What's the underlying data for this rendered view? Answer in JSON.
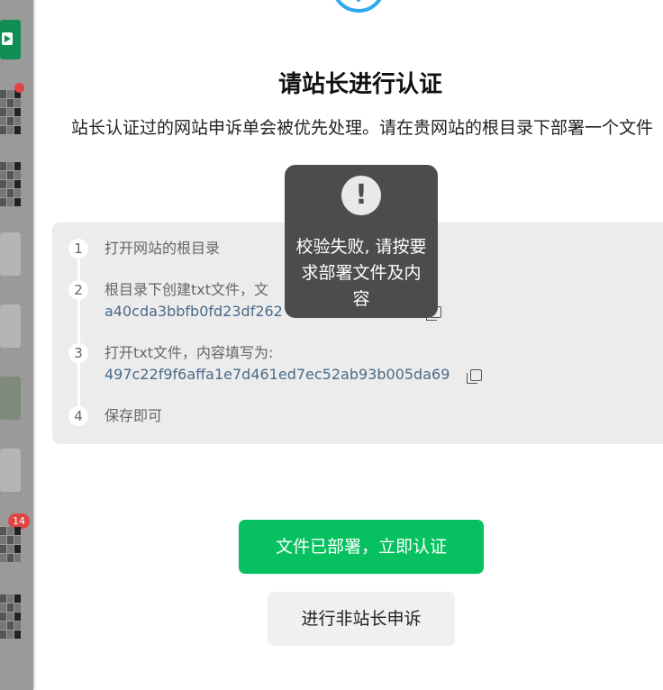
{
  "dialog": {
    "title": "请站长进行认证",
    "description": "站长认证过的网站申诉单会被优先处理。请在贵网站的根目录下部署一个文件"
  },
  "steps": [
    {
      "number": "1",
      "text": "打开网站的根目录"
    },
    {
      "number": "2",
      "text": "根目录下创建txt文件，文",
      "value": "a40cda3bbfb0fd23df262"
    },
    {
      "number": "3",
      "text": "打开txt文件，内容填写为:",
      "value": "497c22f9f6affa1e7d461ed7ec52ab93b005da69"
    },
    {
      "number": "4",
      "text": "保存即可"
    }
  ],
  "toast": {
    "icon": "exclamation-icon",
    "message": "校验失败, 请按要求部署文件及内容"
  },
  "buttons": {
    "confirm_label": "文件已部署，立即认证",
    "appeal_label": "进行非站长申诉"
  },
  "sidebar": {
    "badge_count": "14"
  },
  "colors": {
    "primary": "#07c160",
    "toast_bg": "#4c4c4c",
    "link_value": "#4a6a8a",
    "accent_blue": "#2fa8ef"
  }
}
